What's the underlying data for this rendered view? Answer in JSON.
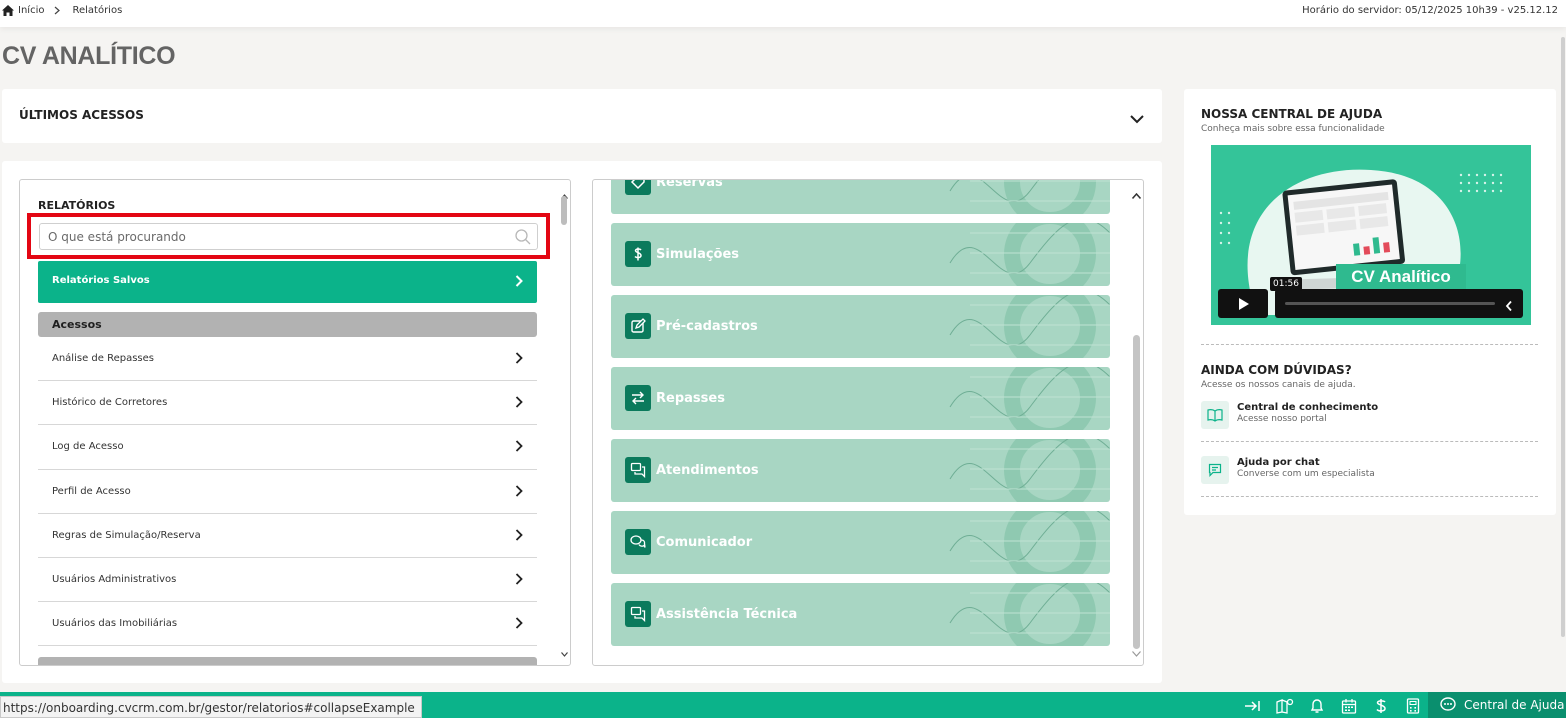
{
  "breadcrumb": {
    "home": "Início",
    "current": "Relatórios"
  },
  "server": {
    "info": "Horário do servidor: 05/12/2025 10h39 - v25.12.12"
  },
  "page": {
    "title": "CV ANALÍTICO"
  },
  "recent": {
    "label": "ÚLTIMOS ACESSOS"
  },
  "reports": {
    "heading": "RELATÓRIOS",
    "search_placeholder": "O que está procurando",
    "saved_label": "Relatórios Salvos",
    "group_label": "Acessos",
    "items": [
      {
        "label": "Análise de Repasses"
      },
      {
        "label": "Histórico de Corretores"
      },
      {
        "label": "Log de Acesso"
      },
      {
        "label": "Perfil de Acesso"
      },
      {
        "label": "Regras de Simulação/Reserva"
      },
      {
        "label": "Usuários Administrativos"
      },
      {
        "label": "Usuários das Imobiliárias"
      }
    ]
  },
  "modules": [
    {
      "label": "Reservas",
      "icon": "tag-icon"
    },
    {
      "label": "Simulações",
      "icon": "dollar-icon"
    },
    {
      "label": "Pré-cadastros",
      "icon": "edit-icon"
    },
    {
      "label": "Repasses",
      "icon": "transfer-icon"
    },
    {
      "label": "Atendimentos",
      "icon": "chat-icon"
    },
    {
      "label": "Comunicador",
      "icon": "chat-bubbles-icon"
    },
    {
      "label": "Assistência Técnica",
      "icon": "chat-icon"
    }
  ],
  "help": {
    "title": "NOSSA CENTRAL DE AJUDA",
    "subtitle": "Conheça mais sobre essa funcionalidade",
    "video": {
      "title": "CV Analítico",
      "time": "01:56"
    },
    "doubts_title": "AINDA COM DÚVIDAS?",
    "doubts_subtitle": "Acesse os nossos canais de ajuda.",
    "links": [
      {
        "title": "Central de conhecimento",
        "desc": "Acesse nosso portal",
        "icon": "book-icon"
      },
      {
        "title": "Ajuda por chat",
        "desc": "Converse com um especialista",
        "icon": "chat-icon"
      }
    ]
  },
  "statusbar": {
    "url": "https://onboarding.cvcrm.com.br/gestor/relatorios#collapseExample",
    "help_label": "Central de Ajuda"
  },
  "colors": {
    "accent": "#0bb38a",
    "card": "#a8d6c3",
    "card_icon": "#0b7a5c",
    "highlight": "#e30613"
  }
}
